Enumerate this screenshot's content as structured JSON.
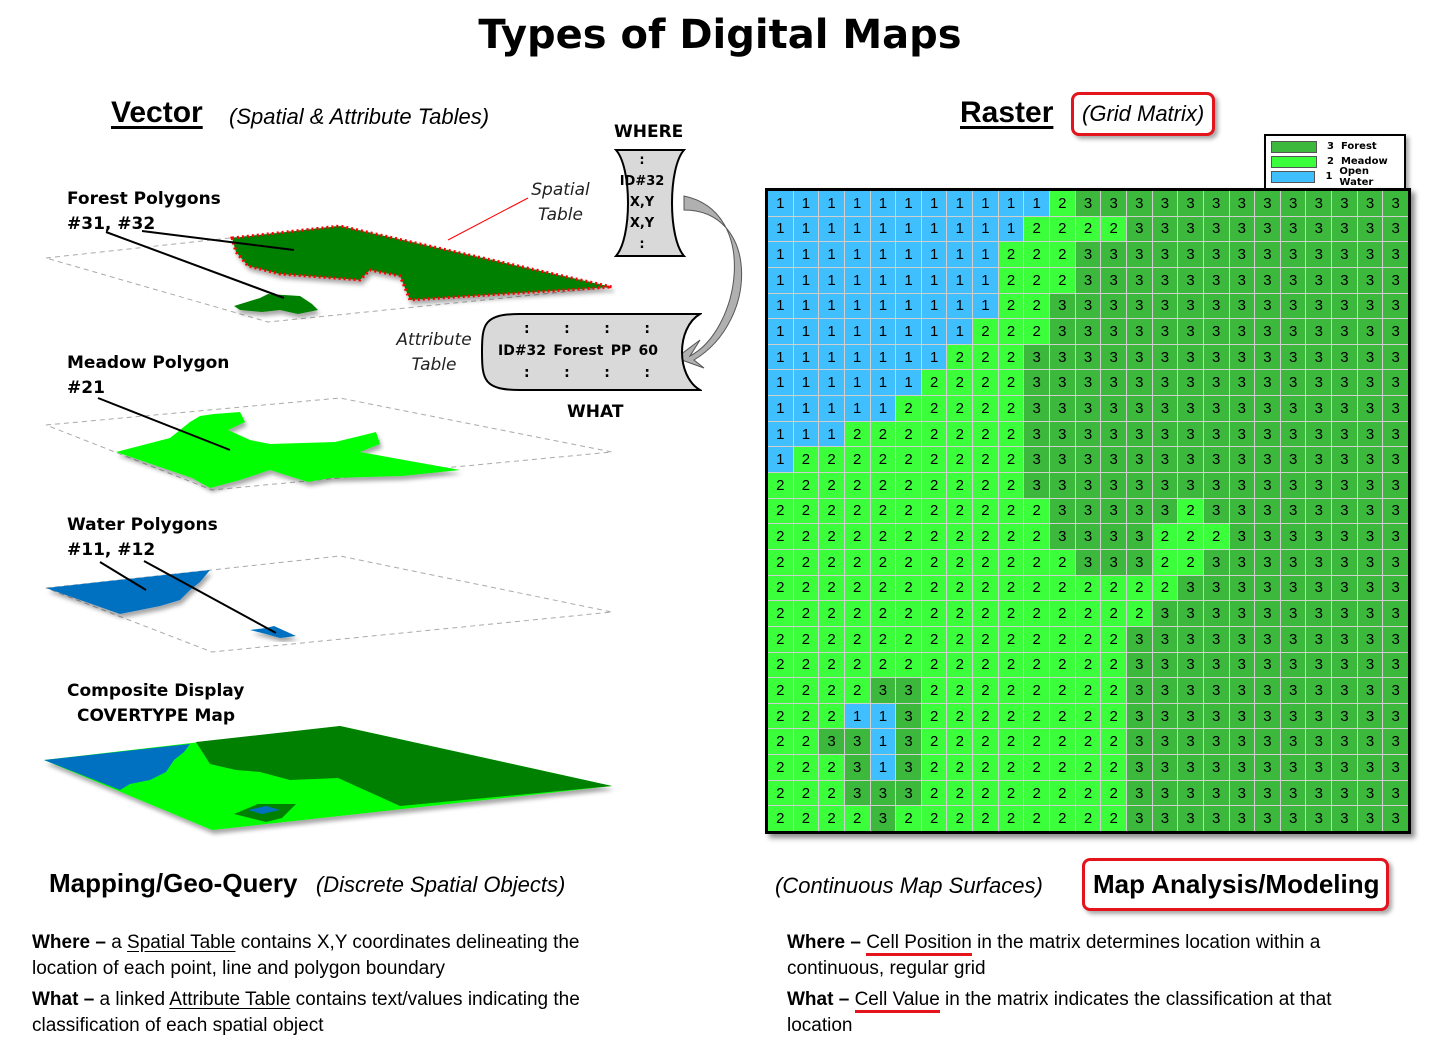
{
  "title": "Types of Digital Maps",
  "vector": {
    "heading": "Vector",
    "subtitle": "(Spatial & Attribute Tables)",
    "layers": [
      {
        "label_line1": "Forest Polygons",
        "label_line2": "#31, #32",
        "color": "#008000"
      },
      {
        "label_line1": "Meadow Polygon",
        "label_line2": "#21",
        "color": "#00ff00"
      },
      {
        "label_line1": "Water Polygons",
        "label_line2": "#11, #12",
        "color": "#0070c0"
      },
      {
        "label_line1": "Composite Display",
        "label_line2": "COVERTYPE Map"
      }
    ],
    "spatial_table": {
      "header": "WHERE",
      "side_label_line1": "Spatial",
      "side_label_line2": "Table",
      "rows": [
        ":",
        "ID#32",
        "X,Y",
        "X,Y",
        ":"
      ]
    },
    "attribute_table": {
      "footer": "WHAT",
      "side_label_line1": "Attribute",
      "side_label_line2": "Table",
      "dots_row": [
        ":",
        ":",
        ":",
        ":"
      ],
      "record": [
        "ID#32",
        "Forest",
        "PP",
        "60"
      ]
    }
  },
  "raster": {
    "heading": "Raster",
    "subtitle": "(Grid Matrix)",
    "legend": [
      {
        "value": "3",
        "label": "Forest",
        "color": "#3cb93c"
      },
      {
        "value": "2",
        "label": "Meadow",
        "color": "#3cff3c"
      },
      {
        "value": "1",
        "label": "Open Water",
        "color": "#40bfff"
      }
    ],
    "grid": [
      [
        1,
        1,
        1,
        1,
        1,
        1,
        1,
        1,
        1,
        1,
        1,
        2,
        3,
        3,
        3,
        3,
        3,
        3,
        3,
        3,
        3,
        3,
        3,
        3,
        3
      ],
      [
        1,
        1,
        1,
        1,
        1,
        1,
        1,
        1,
        1,
        1,
        2,
        2,
        2,
        2,
        3,
        3,
        3,
        3,
        3,
        3,
        3,
        3,
        3,
        3,
        3
      ],
      [
        1,
        1,
        1,
        1,
        1,
        1,
        1,
        1,
        1,
        2,
        2,
        2,
        3,
        3,
        3,
        3,
        3,
        3,
        3,
        3,
        3,
        3,
        3,
        3,
        3
      ],
      [
        1,
        1,
        1,
        1,
        1,
        1,
        1,
        1,
        1,
        2,
        2,
        2,
        3,
        3,
        3,
        3,
        3,
        3,
        3,
        3,
        3,
        3,
        3,
        3,
        3
      ],
      [
        1,
        1,
        1,
        1,
        1,
        1,
        1,
        1,
        1,
        2,
        2,
        3,
        3,
        3,
        3,
        3,
        3,
        3,
        3,
        3,
        3,
        3,
        3,
        3,
        3
      ],
      [
        1,
        1,
        1,
        1,
        1,
        1,
        1,
        1,
        2,
        2,
        2,
        3,
        3,
        3,
        3,
        3,
        3,
        3,
        3,
        3,
        3,
        3,
        3,
        3,
        3
      ],
      [
        1,
        1,
        1,
        1,
        1,
        1,
        1,
        2,
        2,
        2,
        3,
        3,
        3,
        3,
        3,
        3,
        3,
        3,
        3,
        3,
        3,
        3,
        3,
        3,
        3
      ],
      [
        1,
        1,
        1,
        1,
        1,
        1,
        2,
        2,
        2,
        2,
        3,
        3,
        3,
        3,
        3,
        3,
        3,
        3,
        3,
        3,
        3,
        3,
        3,
        3,
        3
      ],
      [
        1,
        1,
        1,
        1,
        1,
        2,
        2,
        2,
        2,
        2,
        3,
        3,
        3,
        3,
        3,
        3,
        3,
        3,
        3,
        3,
        3,
        3,
        3,
        3,
        3
      ],
      [
        1,
        1,
        1,
        2,
        2,
        2,
        2,
        2,
        2,
        2,
        3,
        3,
        3,
        3,
        3,
        3,
        3,
        3,
        3,
        3,
        3,
        3,
        3,
        3,
        3
      ],
      [
        1,
        2,
        2,
        2,
        2,
        2,
        2,
        2,
        2,
        2,
        3,
        3,
        3,
        3,
        3,
        3,
        3,
        3,
        3,
        3,
        3,
        3,
        3,
        3,
        3
      ],
      [
        2,
        2,
        2,
        2,
        2,
        2,
        2,
        2,
        2,
        2,
        3,
        3,
        3,
        3,
        3,
        3,
        3,
        3,
        3,
        3,
        3,
        3,
        3,
        3,
        3
      ],
      [
        2,
        2,
        2,
        2,
        2,
        2,
        2,
        2,
        2,
        2,
        2,
        3,
        3,
        3,
        3,
        3,
        2,
        3,
        3,
        3,
        3,
        3,
        3,
        3,
        3
      ],
      [
        2,
        2,
        2,
        2,
        2,
        2,
        2,
        2,
        2,
        2,
        2,
        3,
        3,
        3,
        3,
        2,
        2,
        2,
        3,
        3,
        3,
        3,
        3,
        3,
        3
      ],
      [
        2,
        2,
        2,
        2,
        2,
        2,
        2,
        2,
        2,
        2,
        2,
        2,
        3,
        3,
        3,
        2,
        2,
        3,
        3,
        3,
        3,
        3,
        3,
        3,
        3
      ],
      [
        2,
        2,
        2,
        2,
        2,
        2,
        2,
        2,
        2,
        2,
        2,
        2,
        2,
        2,
        2,
        2,
        3,
        3,
        3,
        3,
        3,
        3,
        3,
        3,
        3
      ],
      [
        2,
        2,
        2,
        2,
        2,
        2,
        2,
        2,
        2,
        2,
        2,
        2,
        2,
        2,
        2,
        3,
        3,
        3,
        3,
        3,
        3,
        3,
        3,
        3,
        3
      ],
      [
        2,
        2,
        2,
        2,
        2,
        2,
        2,
        2,
        2,
        2,
        2,
        2,
        2,
        2,
        3,
        3,
        3,
        3,
        3,
        3,
        3,
        3,
        3,
        3,
        3
      ],
      [
        2,
        2,
        2,
        2,
        2,
        2,
        2,
        2,
        2,
        2,
        2,
        2,
        2,
        2,
        3,
        3,
        3,
        3,
        3,
        3,
        3,
        3,
        3,
        3,
        3
      ],
      [
        2,
        2,
        2,
        2,
        3,
        3,
        2,
        2,
        2,
        2,
        2,
        2,
        2,
        2,
        3,
        3,
        3,
        3,
        3,
        3,
        3,
        3,
        3,
        3,
        3
      ],
      [
        2,
        2,
        2,
        1,
        1,
        3,
        2,
        2,
        2,
        2,
        2,
        2,
        2,
        2,
        3,
        3,
        3,
        3,
        3,
        3,
        3,
        3,
        3,
        3,
        3
      ],
      [
        2,
        2,
        3,
        3,
        1,
        3,
        2,
        2,
        2,
        2,
        2,
        2,
        2,
        2,
        3,
        3,
        3,
        3,
        3,
        3,
        3,
        3,
        3,
        3,
        3
      ],
      [
        2,
        2,
        2,
        3,
        1,
        3,
        2,
        2,
        2,
        2,
        2,
        2,
        2,
        2,
        3,
        3,
        3,
        3,
        3,
        3,
        3,
        3,
        3,
        3,
        3
      ],
      [
        2,
        2,
        2,
        3,
        3,
        3,
        2,
        2,
        2,
        2,
        2,
        2,
        2,
        2,
        3,
        3,
        3,
        3,
        3,
        3,
        3,
        3,
        3,
        3,
        3
      ],
      [
        2,
        2,
        2,
        2,
        3,
        2,
        2,
        2,
        2,
        2,
        2,
        2,
        2,
        2,
        3,
        3,
        3,
        3,
        3,
        3,
        3,
        3,
        3,
        3,
        3
      ]
    ]
  },
  "bottom_left": {
    "heading": "Mapping/Geo-Query",
    "subtitle": "(Discrete Spatial Objects)",
    "where": {
      "lead": "Where –",
      "pre": " a ",
      "term": "Spatial Table",
      "rest": " contains X,Y coordinates delineating the location of each point, line and polygon boundary"
    },
    "what": {
      "lead": "What –",
      "pre": " a linked ",
      "term": "Attribute Table",
      "rest": " contains text/values indicating the classification of each spatial object"
    }
  },
  "bottom_right": {
    "heading": "Map Analysis/Modeling",
    "subtitle": "(Continuous Map Surfaces)",
    "where": {
      "lead": "Where –",
      "pre": " ",
      "term": "Cell Position",
      "rest": " in the matrix determines location within a continuous, regular grid"
    },
    "what": {
      "lead": "What –",
      "pre": " ",
      "term": "Cell Value",
      "rest": " in the matrix indicates the classification at that location"
    }
  }
}
